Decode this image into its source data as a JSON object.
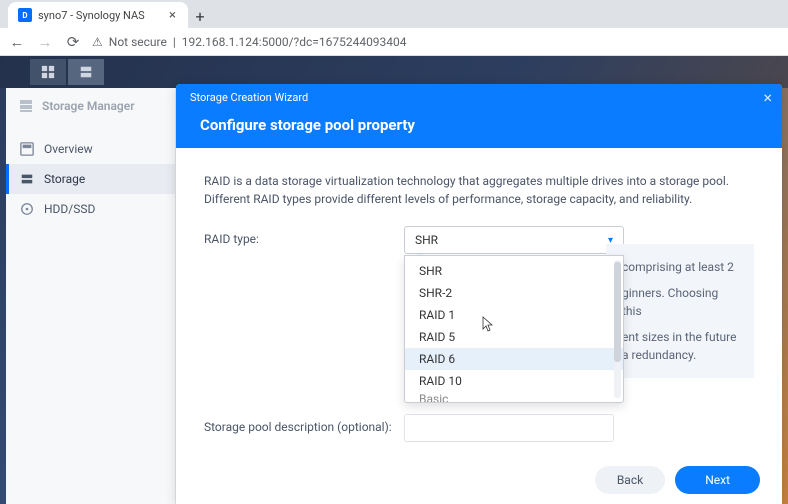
{
  "browser": {
    "tab_title": "syno7 - Synology NAS",
    "not_secure": "Not secure",
    "url": "192.168.1.124:5000/?dc=1675244093404"
  },
  "storage_manager": {
    "title": "Storage Manager",
    "nav": {
      "overview": "Overview",
      "storage": "Storage",
      "hdd_ssd": "HDD/SSD"
    }
  },
  "wizard": {
    "titlebar": "Storage Creation Wizard",
    "heading": "Configure storage pool property",
    "description": "RAID is a data storage virtualization technology that aggregates multiple drives into a storage pool. Different RAID types provide different levels of performance, storage capacity, and reliability.",
    "raid_label": "RAID type:",
    "raid_selected": "SHR",
    "raid_options": [
      "SHR",
      "SHR-2",
      "RAID 1",
      "RAID 5",
      "RAID 6",
      "RAID 10",
      "Basic"
    ],
    "hovered_option_index": 4,
    "info_panel": {
      "line1_fragment": "comprising at least 2",
      "line2_fragment": "ginners. Choosing this",
      "line3_fragment": "ent sizes in the future",
      "line4_fragment": "a redundancy."
    },
    "desc_label": "Storage pool description (optional):",
    "back": "Back",
    "next": "Next"
  }
}
